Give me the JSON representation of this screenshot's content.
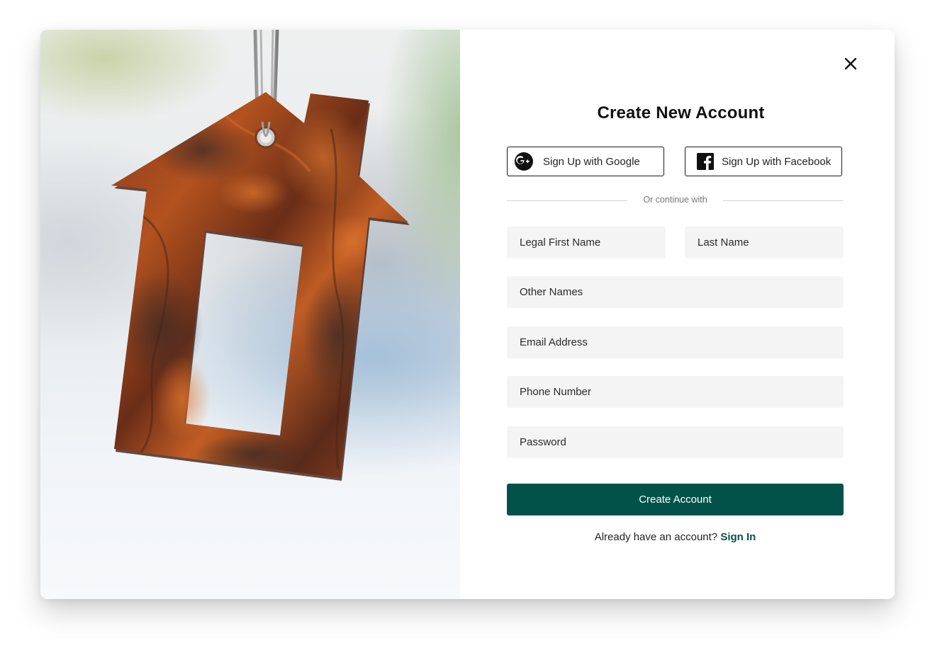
{
  "modal": {
    "title": "Create New Account",
    "social": {
      "google_label": "Sign Up with Google",
      "facebook_label": "Sign Up with Facebook",
      "google_icon": "google-plus-icon",
      "facebook_icon": "facebook-icon"
    },
    "divider_text": "Or continue with",
    "fields": {
      "first_name": "Legal First Name",
      "last_name": "Last Name",
      "other_names": "Other Names",
      "email": "Email Address",
      "phone": "Phone Number",
      "password": "Password"
    },
    "submit_label": "Create Account",
    "signin_prompt": "Already have an account?",
    "signin_link": "Sign In",
    "close_icon": "close-icon"
  },
  "colors": {
    "primary": "#02524a",
    "link": "#0c5148",
    "field_bg": "#f4f4f4"
  }
}
